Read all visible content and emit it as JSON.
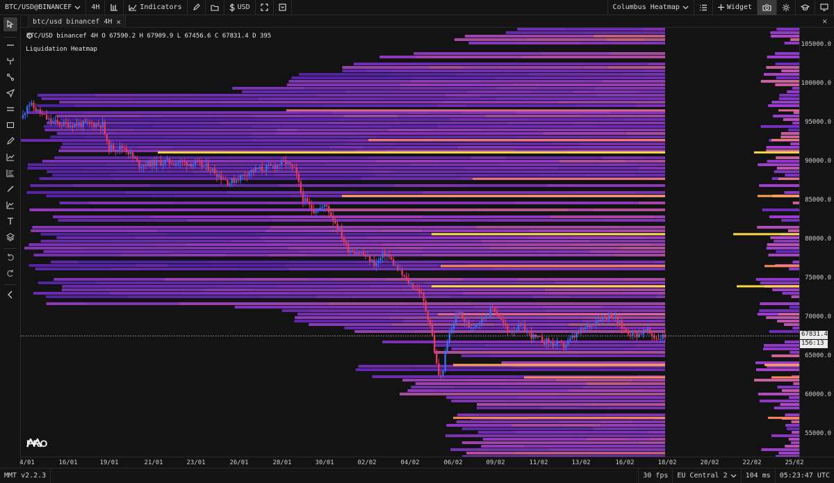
{
  "toolbar": {
    "symbol": "BTC/USD@BINANCEF",
    "timeframe": "4H",
    "indicators": "Indicators",
    "currency": "USD",
    "heatmap": "Columbus Heatmap",
    "widget": "Widget"
  },
  "tab": {
    "label": "btc/usd binancef 4H"
  },
  "legend": {
    "line": "BTC/USD binancef 4H  O 67590.2  H 67909.9  L 67456.6  C 67831.4  D 395",
    "indicator": "Liquidation Heatmap"
  },
  "logo": {
    "text": "PRO"
  },
  "price_axis": {
    "ticks": [
      "105000.0",
      "100000.0",
      "95000.0",
      "90000.0",
      "85000.0",
      "80000.0",
      "75000.0",
      "70000.0",
      "65000.0",
      "60000.0",
      "55000.0"
    ],
    "current_price": "67831.4",
    "countdown": "156:13"
  },
  "time_axis": {
    "ticks": [
      "4/01",
      "16/01",
      "19/01",
      "21/01",
      "23/01",
      "26/01",
      "28/01",
      "30/01",
      "02/02",
      "04/02",
      "06/02",
      "09/02",
      "11/02",
      "13/02",
      "16/02",
      "18/02",
      "20/02",
      "22/02",
      "25/02"
    ]
  },
  "status": {
    "version": "MMT v2.2.3",
    "fps": "30 fps",
    "region": "EU Central 2",
    "latency": "104 ms",
    "clock": "05:23:47 UTC"
  },
  "colors": {
    "background": "#131313",
    "candle_up": "#3b6cf0",
    "candle_down": "#e23a5f",
    "heat_low": "#3a1aa8",
    "heat_mid": "#a23fd0",
    "heat_high": "#ff8a5a",
    "heat_max": "#ffd84a"
  },
  "icons": [
    "chevron-down-icon",
    "bar-chart-icon",
    "indicators-icon",
    "pencil-icon",
    "folder-icon",
    "dollar-icon",
    "fullscreen-icon",
    "layout-icon",
    "menu-icon",
    "plus-icon",
    "camera-icon",
    "gear-icon",
    "graduation-cap-icon",
    "monitor-icon",
    "cursor-icon",
    "line-icon",
    "fork-icon",
    "path-icon",
    "arrow-icon",
    "parallel-icon",
    "rectangle-icon",
    "brush-icon",
    "chart-line-icon",
    "levels-icon",
    "ruler-icon",
    "projection-icon",
    "text-icon",
    "layers-icon",
    "undo-icon",
    "redo-icon",
    "collapse-icon",
    "close-icon",
    "logo-icon"
  ]
}
